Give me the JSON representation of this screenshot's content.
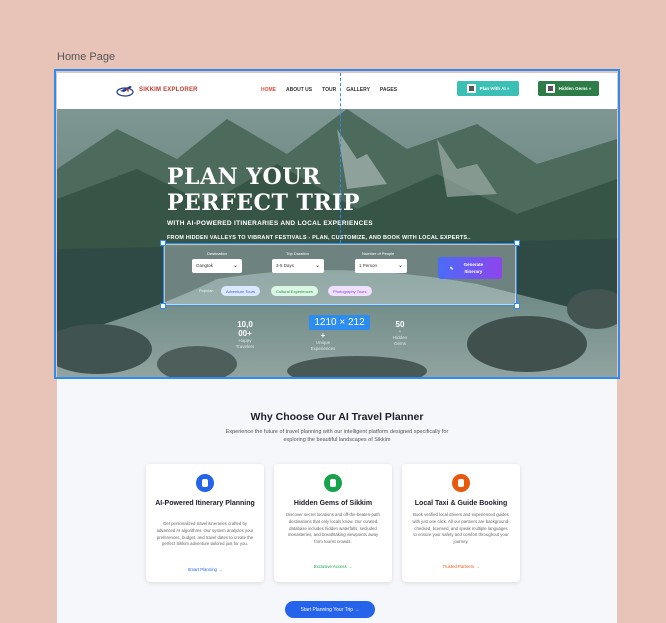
{
  "frame_label": "Home Page",
  "nav": {
    "brand": "SIKKIM EXPLORER",
    "links": [
      "HOME",
      "ABOUT US",
      "TOUR",
      "GALLERY",
      "PAGES"
    ],
    "plan_ai": "Plan With AI »",
    "hidden_gems": "Hidden Gems »"
  },
  "hero": {
    "title_line1": "PLAN YOUR",
    "title_line2": "PERFECT TRIP",
    "subtitle": "WITH AI-POWERED ITINERARIES AND LOCAL EXPERIENCES",
    "tagline": "FROM HIDDEN VALLEYS TO VIBRANT FESTIVALS - PLAN, CUSTOMIZE, AND  BOOK WITH LOCAL EXPERTS..",
    "form": {
      "destination_label": "Destination",
      "destination_value": "Gangtok",
      "duration_label": "Trip Duration",
      "duration_value": "3-5 Days",
      "people_label": "Number of People",
      "people_value": "1 Person",
      "generate": "Generate Itinerary",
      "popular_label": "Popular:",
      "chips": [
        "Adventure Tours",
        "Cultural Experiences",
        "Photography Tours"
      ]
    },
    "stats": [
      {
        "num": "10,0\n00+",
        "label": "Happy\nTravelers"
      },
      {
        "num": "+",
        "label": "Unique\nExperiences"
      },
      {
        "num": "50",
        "label": "+\nHidden\nGems"
      }
    ]
  },
  "selection": {
    "dimensions": "1210 × 212"
  },
  "why": {
    "title": "Why Choose Our AI Travel Planner",
    "description": "Experience the future of travel planning with our intelligent platform designed specifically for exploring the beautiful landscapes of Sikkim",
    "cards": [
      {
        "title": "AI-Powered Itinerary Planning",
        "text": "Get personalized travel itineraries crafted by advanced AI algorithms. Our system analyzes your preferences, budget, and travel dates to create the perfect Sikkim adventure tailored just for you.",
        "link": "Smart Planning →",
        "color": "#2563eb",
        "icon": "brain-icon"
      },
      {
        "title": "Hidden Gems of Sikkim",
        "text": "Discover secret locations and off-the-beaten-path destinations that only locals know. Our curated database includes hidden waterfalls, secluded monasteries, and breathtaking viewpoints away from tourist crowds.",
        "link": "Exclusive Access →",
        "color": "#16a34a",
        "icon": "gem-icon"
      },
      {
        "title": "Local Taxi & Guide Booking",
        "text": "Book verified local drivers and experienced guides with just one click. All our partners are background-checked, licensed, and speak multiple languages to ensure your safety and comfort throughout your journey.",
        "link": "Trusted Partners →",
        "color": "#ea580c",
        "icon": "car-icon"
      }
    ],
    "cta": "Start Planning Your Trip →"
  }
}
